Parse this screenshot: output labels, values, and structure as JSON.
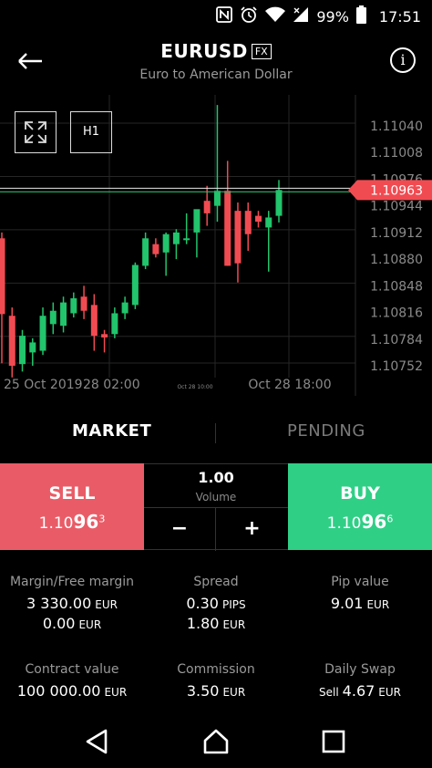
{
  "status_bar": {
    "battery": "99%",
    "time": "17:51",
    "icons": [
      "nfc-icon",
      "alarm-icon",
      "wifi-icon",
      "signal-icon",
      "battery-icon"
    ]
  },
  "header": {
    "symbol": "EURUSD",
    "badge": "FX",
    "subtitle": "Euro to American Dollar",
    "info_glyph": "i"
  },
  "chart": {
    "timeframe_label": "H1",
    "current_price": "1.10963",
    "price_ticks": [
      "1.11040",
      "1.11008",
      "1.10976",
      "1.10944",
      "1.10912",
      "1.10880",
      "1.10848",
      "1.10816",
      "1.10784",
      "1.10752"
    ],
    "time_labels": [
      "25 Oct 2019",
      "28 02:00",
      "Oct 28 10:00",
      "Oct 28 18:00"
    ],
    "colors": {
      "up": "#22c46c",
      "down": "#f14b52",
      "price_line": "#e8e8e8",
      "bid_line": "#27b96a",
      "grid": "#262626"
    }
  },
  "chart_data": {
    "type": "candlestick",
    "price_axis_ticks": [
      1.1104,
      1.11008,
      1.10976,
      1.10944,
      1.10912,
      1.1088,
      1.10848,
      1.10816,
      1.10784,
      1.10752
    ],
    "current_price": 1.10963,
    "candles": [
      {
        "o": 1.10905,
        "h": 1.10912,
        "l": 1.10755,
        "c": 1.10814
      },
      {
        "o": 1.10812,
        "h": 1.10822,
        "l": 1.10738,
        "c": 1.10752
      },
      {
        "o": 1.10754,
        "h": 1.10795,
        "l": 1.10745,
        "c": 1.10788
      },
      {
        "o": 1.10768,
        "h": 1.10785,
        "l": 1.10752,
        "c": 1.1078
      },
      {
        "o": 1.1077,
        "h": 1.10822,
        "l": 1.10765,
        "c": 1.10812
      },
      {
        "o": 1.10802,
        "h": 1.10828,
        "l": 1.1079,
        "c": 1.10818
      },
      {
        "o": 1.108,
        "h": 1.10835,
        "l": 1.10792,
        "c": 1.10828
      },
      {
        "o": 1.10815,
        "h": 1.1084,
        "l": 1.1081,
        "c": 1.10833
      },
      {
        "o": 1.10835,
        "h": 1.10848,
        "l": 1.10808,
        "c": 1.10818
      },
      {
        "o": 1.10825,
        "h": 1.10838,
        "l": 1.1077,
        "c": 1.10788
      },
      {
        "o": 1.1079,
        "h": 1.10795,
        "l": 1.10768,
        "c": 1.10786
      },
      {
        "o": 1.1079,
        "h": 1.10822,
        "l": 1.10785,
        "c": 1.10815
      },
      {
        "o": 1.10815,
        "h": 1.10835,
        "l": 1.10808,
        "c": 1.10828
      },
      {
        "o": 1.10825,
        "h": 1.10876,
        "l": 1.1082,
        "c": 1.10873
      },
      {
        "o": 1.10872,
        "h": 1.10912,
        "l": 1.10868,
        "c": 1.10905
      },
      {
        "o": 1.10898,
        "h": 1.10905,
        "l": 1.10882,
        "c": 1.10886
      },
      {
        "o": 1.10888,
        "h": 1.10912,
        "l": 1.1086,
        "c": 1.1091
      },
      {
        "o": 1.10898,
        "h": 1.10916,
        "l": 1.1088,
        "c": 1.10912
      },
      {
        "o": 1.10905,
        "h": 1.10935,
        "l": 1.10898,
        "c": 1.10905
      },
      {
        "o": 1.10912,
        "h": 1.10935,
        "l": 1.10882,
        "c": 1.1094
      },
      {
        "o": 1.1095,
        "h": 1.10968,
        "l": 1.1092,
        "c": 1.10935
      },
      {
        "o": 1.10944,
        "h": 1.11065,
        "l": 1.10925,
        "c": 1.10962
      },
      {
        "o": 1.10962,
        "h": 1.10998,
        "l": 1.10872,
        "c": 1.10872
      },
      {
        "o": 1.10938,
        "h": 1.10948,
        "l": 1.10852,
        "c": 1.10875
      },
      {
        "o": 1.10938,
        "h": 1.10948,
        "l": 1.1089,
        "c": 1.1091
      },
      {
        "o": 1.10932,
        "h": 1.10938,
        "l": 1.10918,
        "c": 1.10925
      },
      {
        "o": 1.10918,
        "h": 1.10938,
        "l": 1.10865,
        "c": 1.1093
      },
      {
        "o": 1.10932,
        "h": 1.10975,
        "l": 1.10924,
        "c": 1.10963
      }
    ]
  },
  "tabs": {
    "market": "MARKET",
    "pending": "PENDING"
  },
  "trade": {
    "sell": {
      "label": "SELL",
      "price_head": "1.10",
      "price_big": "96",
      "price_tail": "3"
    },
    "buy": {
      "label": "BUY",
      "price_head": "1.10",
      "price_big": "96",
      "price_tail": "6"
    },
    "volume": {
      "value": "1.00",
      "label": "Volume",
      "minus": "−",
      "plus": "+"
    },
    "colors": {
      "sell": "#e95c67",
      "buy": "#2fcf86"
    }
  },
  "info": {
    "margin": {
      "label": "Margin/Free margin",
      "v1": "3 330.00",
      "u1": "EUR",
      "v2": "0.00",
      "u2": "EUR"
    },
    "spread": {
      "label": "Spread",
      "v1": "0.30",
      "u1": "PIPS",
      "v2": "1.80",
      "u2": "EUR"
    },
    "pip": {
      "label": "Pip value",
      "v1": "9.01",
      "u1": "EUR"
    },
    "contract": {
      "label": "Contract value",
      "v1": "100 000.00",
      "u1": "EUR"
    },
    "commission": {
      "label": "Commission",
      "v1": "3.50",
      "u1": "EUR"
    },
    "swap": {
      "label": "Daily Swap",
      "pre": "Sell",
      "v1": "4.67",
      "u1": "EUR"
    }
  }
}
